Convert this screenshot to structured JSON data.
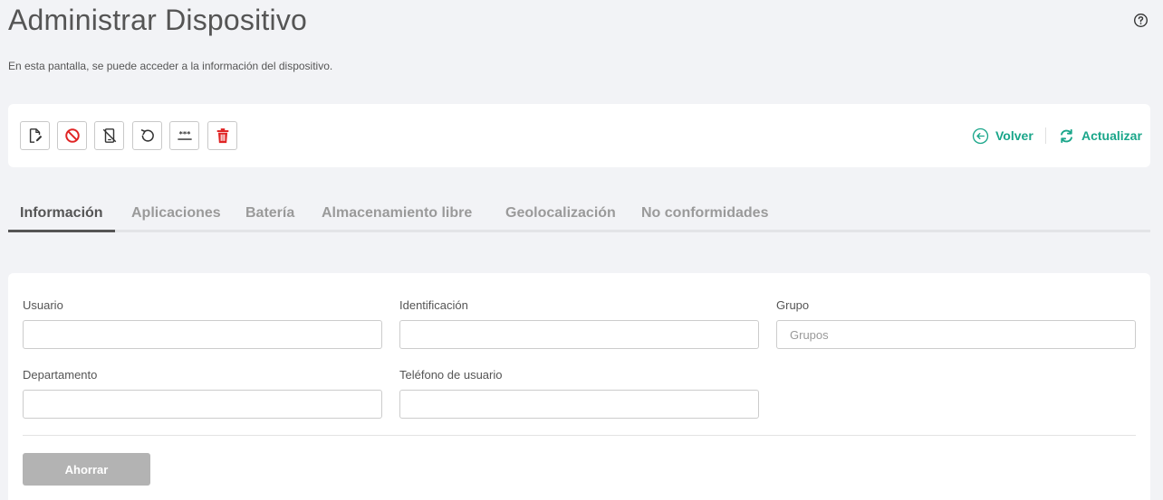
{
  "header": {
    "title": "Administrar Dispositivo",
    "subtitle": "En esta pantalla, se puede acceder a la información del dispositivo.",
    "help_icon": "help-circle-icon"
  },
  "toolbar": {
    "actions": [
      {
        "name": "edit-document",
        "icon": "edit-document-icon",
        "color": "#333333"
      },
      {
        "name": "block",
        "icon": "block-icon",
        "color": "#e02424"
      },
      {
        "name": "disable-device",
        "icon": "device-off-icon",
        "color": "#333333"
      },
      {
        "name": "restart",
        "icon": "restart-icon",
        "color": "#333333"
      },
      {
        "name": "password",
        "icon": "password-icon",
        "color": "#333333"
      },
      {
        "name": "delete",
        "icon": "trash-icon",
        "color": "#e02424"
      }
    ],
    "back_label": "Volver",
    "refresh_label": "Actualizar",
    "accent_color": "#1aa68a"
  },
  "tabs": [
    {
      "label": "Información",
      "active": true
    },
    {
      "label": "Aplicaciones",
      "active": false
    },
    {
      "label": "Batería",
      "active": false
    },
    {
      "label": "Almacenamiento libre",
      "active": false
    },
    {
      "label": "Geolocalización",
      "active": false
    },
    {
      "label": "No conformidades",
      "active": false
    }
  ],
  "form": {
    "usuario": {
      "label": "Usuario",
      "value": "",
      "placeholder": ""
    },
    "identificacion": {
      "label": "Identificación",
      "value": "",
      "placeholder": ""
    },
    "grupo": {
      "label": "Grupo",
      "value": "",
      "placeholder": "Grupos"
    },
    "departamento": {
      "label": "Departamento",
      "value": "",
      "placeholder": ""
    },
    "telefono": {
      "label": "Teléfono de usuario",
      "value": "",
      "placeholder": ""
    },
    "save_label": "Ahorrar"
  }
}
